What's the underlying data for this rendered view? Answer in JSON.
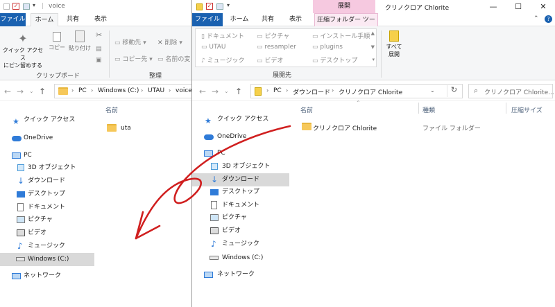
{
  "left": {
    "title": "voice",
    "tabs": [
      "ファイル",
      "ホーム",
      "共有",
      "表示"
    ],
    "ribbon": {
      "pin": [
        "クイック アクセス",
        "にピン留めする"
      ],
      "copy": "コピー",
      "paste": "貼り付け",
      "group_clipboard": "クリップボード",
      "move": "移動先",
      "copyto": "コピー先",
      "delete": "削除",
      "rename": "名前の変",
      "group_organize": "整理"
    },
    "breadcrumb": [
      "PC",
      "Windows (C:)",
      "UTAU",
      "voice"
    ],
    "nav": [
      "クイック アクセス",
      "OneDrive",
      "PC",
      "3D オブジェクト",
      "ダウンロード",
      "デスクトップ",
      "ドキュメント",
      "ピクチャ",
      "ビデオ",
      "ミュージック",
      "Windows (C:)",
      "ネットワーク"
    ],
    "col_name": "名前",
    "files": [
      "uta"
    ]
  },
  "right": {
    "context_tab": "展開",
    "title": "クリノクロア Chlorite",
    "tabs": [
      "ファイル",
      "ホーム",
      "共有",
      "表示",
      "圧縮フォルダー ツール"
    ],
    "ribbon_items": [
      [
        "ドキュメント",
        "ピクチャ",
        "インストール手順"
      ],
      [
        "UTAU",
        "resampler",
        "plugins"
      ],
      [
        "ミュージック",
        "ビデオ",
        "デスクトップ"
      ]
    ],
    "group_extract_to": "展開先",
    "extract_all": [
      "すべて",
      "展開"
    ],
    "breadcrumb": [
      "PC",
      "ダウンロード",
      "クリノクロア Chlorite"
    ],
    "search_placeholder": "クリノクロア Chlorite...",
    "nav": [
      "クイック アクセス",
      "OneDrive",
      "PC",
      "3D オブジェクト",
      "ダウンロード",
      "デスクトップ",
      "ドキュメント",
      "ピクチャ",
      "ビデオ",
      "ミュージック",
      "Windows (C:)",
      "ネットワーク"
    ],
    "columns": [
      "名前",
      "種類",
      "圧縮サイズ"
    ],
    "files": [
      {
        "name": "クリノクロア Chlorite",
        "type": "ファイル フォルダー"
      }
    ]
  },
  "colors": {
    "accent": "#1a61b0",
    "context_tab": "#f6c9e0",
    "annotation": "#d01f1f",
    "selection": "#d9d9d9"
  }
}
